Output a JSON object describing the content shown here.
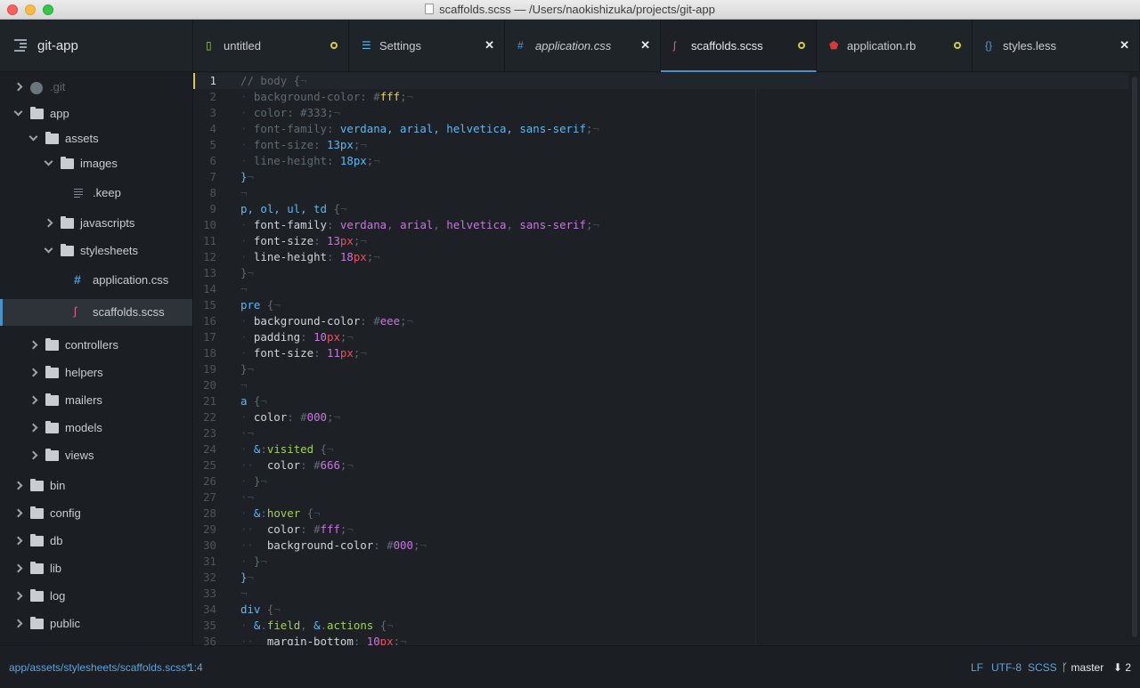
{
  "window": {
    "title": "scaffolds.scss — /Users/naokishizuka/projects/git-app"
  },
  "sidebar": {
    "project": "git-app",
    "tree": [
      {
        "label": ".git",
        "icon": "github-icon",
        "level": 0,
        "expand": "right",
        "dim": true
      },
      {
        "label": "app",
        "icon": "folder-icon",
        "level": 0,
        "expand": "down"
      },
      {
        "label": "assets",
        "icon": "folder-icon",
        "level": 1,
        "expand": "down"
      },
      {
        "label": "images",
        "icon": "folder-icon",
        "level": 2,
        "expand": "down"
      },
      {
        "label": ".keep",
        "icon": "file-text-icon",
        "level": 3,
        "expand": "none"
      },
      {
        "label": "javascripts",
        "icon": "folder-icon",
        "level": 2,
        "expand": "right"
      },
      {
        "label": "stylesheets",
        "icon": "folder-icon",
        "level": 2,
        "expand": "down"
      },
      {
        "label": "application.css",
        "icon": "css-hash-icon",
        "level": 3,
        "expand": "none"
      },
      {
        "label": "scaffolds.scss",
        "icon": "sass-icon",
        "level": 3,
        "expand": "none",
        "selected": true
      },
      {
        "label": "controllers",
        "icon": "folder-icon",
        "level": 1,
        "expand": "right"
      },
      {
        "label": "helpers",
        "icon": "folder-icon",
        "level": 1,
        "expand": "right"
      },
      {
        "label": "mailers",
        "icon": "folder-icon",
        "level": 1,
        "expand": "right"
      },
      {
        "label": "models",
        "icon": "folder-icon",
        "level": 1,
        "expand": "right"
      },
      {
        "label": "views",
        "icon": "folder-icon",
        "level": 1,
        "expand": "right"
      },
      {
        "label": "bin",
        "icon": "folder-icon",
        "level": 0,
        "expand": "right"
      },
      {
        "label": "config",
        "icon": "folder-icon",
        "level": 0,
        "expand": "right"
      },
      {
        "label": "db",
        "icon": "folder-icon",
        "level": 0,
        "expand": "right"
      },
      {
        "label": "lib",
        "icon": "folder-icon",
        "level": 0,
        "expand": "right"
      },
      {
        "label": "log",
        "icon": "folder-icon",
        "level": 0,
        "expand": "right"
      },
      {
        "label": "public",
        "icon": "folder-icon",
        "level": 0,
        "expand": "right"
      }
    ]
  },
  "tabs": [
    {
      "label": "untitled",
      "icon": "file-icon",
      "icon_color": "#a0cf5d",
      "state": "modified"
    },
    {
      "label": "Settings",
      "icon": "sliders-icon",
      "icon_color": "#61b6ef",
      "state": "close"
    },
    {
      "label": "application.css",
      "icon": "css-hash-icon",
      "icon_color": "#4d9fd6",
      "state": "close",
      "italic": true
    },
    {
      "label": "scaffolds.scss",
      "icon": "sass-icon",
      "icon_color": "#e15f8f",
      "state": "modified",
      "active": true
    },
    {
      "label": "application.rb",
      "icon": "ruby-icon",
      "icon_color": "#d33b3b",
      "state": "modified"
    },
    {
      "label": "styles.less",
      "icon": "less-braces-icon",
      "icon_color": "#4d9fd6",
      "state": "close"
    }
  ],
  "editor": {
    "cursor_line": 1,
    "lines": [
      [
        [
          "cm",
          "// body {"
        ],
        [
          "inv",
          "¬"
        ]
      ],
      [
        [
          "inv",
          "·"
        ],
        [
          "cm",
          " background-color: "
        ],
        [
          "cm",
          "#"
        ],
        [
          "ycol",
          "fff"
        ],
        [
          "cm",
          ";"
        ],
        [
          "inv",
          "¬"
        ]
      ],
      [
        [
          "inv",
          "·"
        ],
        [
          "cm",
          " color: "
        ],
        [
          "cm",
          "#333;"
        ],
        [
          "inv",
          "¬"
        ]
      ],
      [
        [
          "inv",
          "·"
        ],
        [
          "cm",
          " font-family: "
        ],
        [
          "val",
          "verdana, arial, helvetica, sans-serif"
        ],
        [
          "cm",
          ";"
        ],
        [
          "inv",
          "¬"
        ]
      ],
      [
        [
          "inv",
          "·"
        ],
        [
          "cm",
          " font-size: "
        ],
        [
          "val",
          "13px"
        ],
        [
          "cm",
          ";"
        ],
        [
          "inv",
          "¬"
        ]
      ],
      [
        [
          "inv",
          "·"
        ],
        [
          "cm",
          " line-height: "
        ],
        [
          "val",
          "18px"
        ],
        [
          "cm",
          ";"
        ],
        [
          "inv",
          "¬"
        ]
      ],
      [
        [
          "brace",
          "}"
        ],
        [
          "inv",
          "¬"
        ]
      ],
      [
        [
          "inv",
          "¬"
        ]
      ],
      [
        [
          "sel",
          "p, ol, ul, td"
        ],
        [
          "punc",
          " {"
        ],
        [
          "inv",
          "¬"
        ]
      ],
      [
        [
          "inv",
          "·"
        ],
        [
          "prop",
          " font-family"
        ],
        [
          "punc",
          ": "
        ],
        [
          "num",
          "verdana"
        ],
        [
          "punc",
          ", "
        ],
        [
          "num",
          "arial"
        ],
        [
          "punc",
          ", "
        ],
        [
          "num",
          "helvetica"
        ],
        [
          "punc",
          ", "
        ],
        [
          "num",
          "sans-serif"
        ],
        [
          "punc",
          ";"
        ],
        [
          "inv",
          "¬"
        ]
      ],
      [
        [
          "inv",
          "·"
        ],
        [
          "prop",
          " font-size"
        ],
        [
          "punc",
          ": "
        ],
        [
          "num",
          "13"
        ],
        [
          "unit",
          "px"
        ],
        [
          "punc",
          ";"
        ],
        [
          "inv",
          "¬"
        ]
      ],
      [
        [
          "inv",
          "·"
        ],
        [
          "prop",
          " line-height"
        ],
        [
          "punc",
          ": "
        ],
        [
          "num",
          "18"
        ],
        [
          "unit",
          "px"
        ],
        [
          "punc",
          ";"
        ],
        [
          "inv",
          "¬"
        ]
      ],
      [
        [
          "punc",
          "}"
        ],
        [
          "inv",
          "¬"
        ]
      ],
      [
        [
          "inv",
          "¬"
        ]
      ],
      [
        [
          "sel",
          "pre"
        ],
        [
          "punc",
          " {"
        ],
        [
          "inv",
          "¬"
        ]
      ],
      [
        [
          "inv",
          "·"
        ],
        [
          "prop",
          " background-color"
        ],
        [
          "punc",
          ": "
        ],
        [
          "punc",
          "#"
        ],
        [
          "num",
          "eee"
        ],
        [
          "punc",
          ";"
        ],
        [
          "inv",
          "¬"
        ]
      ],
      [
        [
          "inv",
          "·"
        ],
        [
          "prop",
          " padding"
        ],
        [
          "punc",
          ": "
        ],
        [
          "num",
          "10"
        ],
        [
          "unit",
          "px"
        ],
        [
          "punc",
          ";"
        ],
        [
          "inv",
          "¬"
        ]
      ],
      [
        [
          "inv",
          "·"
        ],
        [
          "prop",
          " font-size"
        ],
        [
          "punc",
          ": "
        ],
        [
          "num",
          "11"
        ],
        [
          "unit",
          "px"
        ],
        [
          "punc",
          ";"
        ],
        [
          "inv",
          "¬"
        ]
      ],
      [
        [
          "punc",
          "}"
        ],
        [
          "inv",
          "¬"
        ]
      ],
      [
        [
          "inv",
          "¬"
        ]
      ],
      [
        [
          "sel",
          "a"
        ],
        [
          "punc",
          " {"
        ],
        [
          "inv",
          "¬"
        ]
      ],
      [
        [
          "inv",
          "·"
        ],
        [
          "prop",
          " color"
        ],
        [
          "punc",
          ": "
        ],
        [
          "punc",
          "#"
        ],
        [
          "num",
          "000"
        ],
        [
          "punc",
          ";"
        ],
        [
          "inv",
          "¬"
        ]
      ],
      [
        [
          "inv",
          "·"
        ],
        [
          "inv",
          "¬"
        ]
      ],
      [
        [
          "inv",
          "·"
        ],
        [
          "amp",
          " &"
        ],
        [
          "punc",
          ":"
        ],
        [
          "pseudo",
          "visited"
        ],
        [
          "punc",
          " {"
        ],
        [
          "inv",
          "¬"
        ]
      ],
      [
        [
          "inv",
          "··"
        ],
        [
          "prop",
          "  color"
        ],
        [
          "punc",
          ": "
        ],
        [
          "punc",
          "#"
        ],
        [
          "num",
          "666"
        ],
        [
          "punc",
          ";"
        ],
        [
          "inv",
          "¬"
        ]
      ],
      [
        [
          "inv",
          "·"
        ],
        [
          "punc",
          " }"
        ],
        [
          "inv",
          "¬"
        ]
      ],
      [
        [
          "inv",
          "·"
        ],
        [
          "inv",
          "¬"
        ]
      ],
      [
        [
          "inv",
          "·"
        ],
        [
          "amp",
          " &"
        ],
        [
          "punc",
          ":"
        ],
        [
          "pseudo",
          "hover"
        ],
        [
          "punc",
          " {"
        ],
        [
          "inv",
          "¬"
        ]
      ],
      [
        [
          "inv",
          "··"
        ],
        [
          "prop",
          "  color"
        ],
        [
          "punc",
          ": "
        ],
        [
          "punc",
          "#"
        ],
        [
          "num",
          "fff"
        ],
        [
          "punc",
          ";"
        ],
        [
          "inv",
          "¬"
        ]
      ],
      [
        [
          "inv",
          "··"
        ],
        [
          "prop",
          "  background-color"
        ],
        [
          "punc",
          ": "
        ],
        [
          "punc",
          "#"
        ],
        [
          "num",
          "000"
        ],
        [
          "punc",
          ";"
        ],
        [
          "inv",
          "¬"
        ]
      ],
      [
        [
          "inv",
          "·"
        ],
        [
          "punc",
          " }"
        ],
        [
          "inv",
          "¬"
        ]
      ],
      [
        [
          "brace",
          "}"
        ],
        [
          "inv",
          "¬"
        ]
      ],
      [
        [
          "inv",
          "¬"
        ]
      ],
      [
        [
          "sel",
          "div"
        ],
        [
          "punc",
          " {"
        ],
        [
          "inv",
          "¬"
        ]
      ],
      [
        [
          "inv",
          "·"
        ],
        [
          "amp",
          " &"
        ],
        [
          "punc",
          "."
        ],
        [
          "pseudo",
          "field"
        ],
        [
          "punc",
          ", "
        ],
        [
          "amp",
          "&"
        ],
        [
          "punc",
          "."
        ],
        [
          "pseudo",
          "actions"
        ],
        [
          "punc",
          " {"
        ],
        [
          "inv",
          "¬"
        ]
      ],
      [
        [
          "inv",
          "··"
        ],
        [
          "prop",
          "  margin-bottom"
        ],
        [
          "punc",
          ": "
        ],
        [
          "num",
          "10"
        ],
        [
          "unit",
          "px"
        ],
        [
          "punc",
          ";"
        ],
        [
          "inv",
          "¬"
        ]
      ]
    ]
  },
  "status": {
    "path": "app/assets/stylesheets/scaffolds.scss*",
    "position": "1:4",
    "line_ending": "LF",
    "encoding": "UTF-8",
    "grammar": "SCSS",
    "branch": "master",
    "behind": "2"
  },
  "colors": {
    "accent": "#4d8fc7",
    "modified": "#d8cc3a"
  }
}
